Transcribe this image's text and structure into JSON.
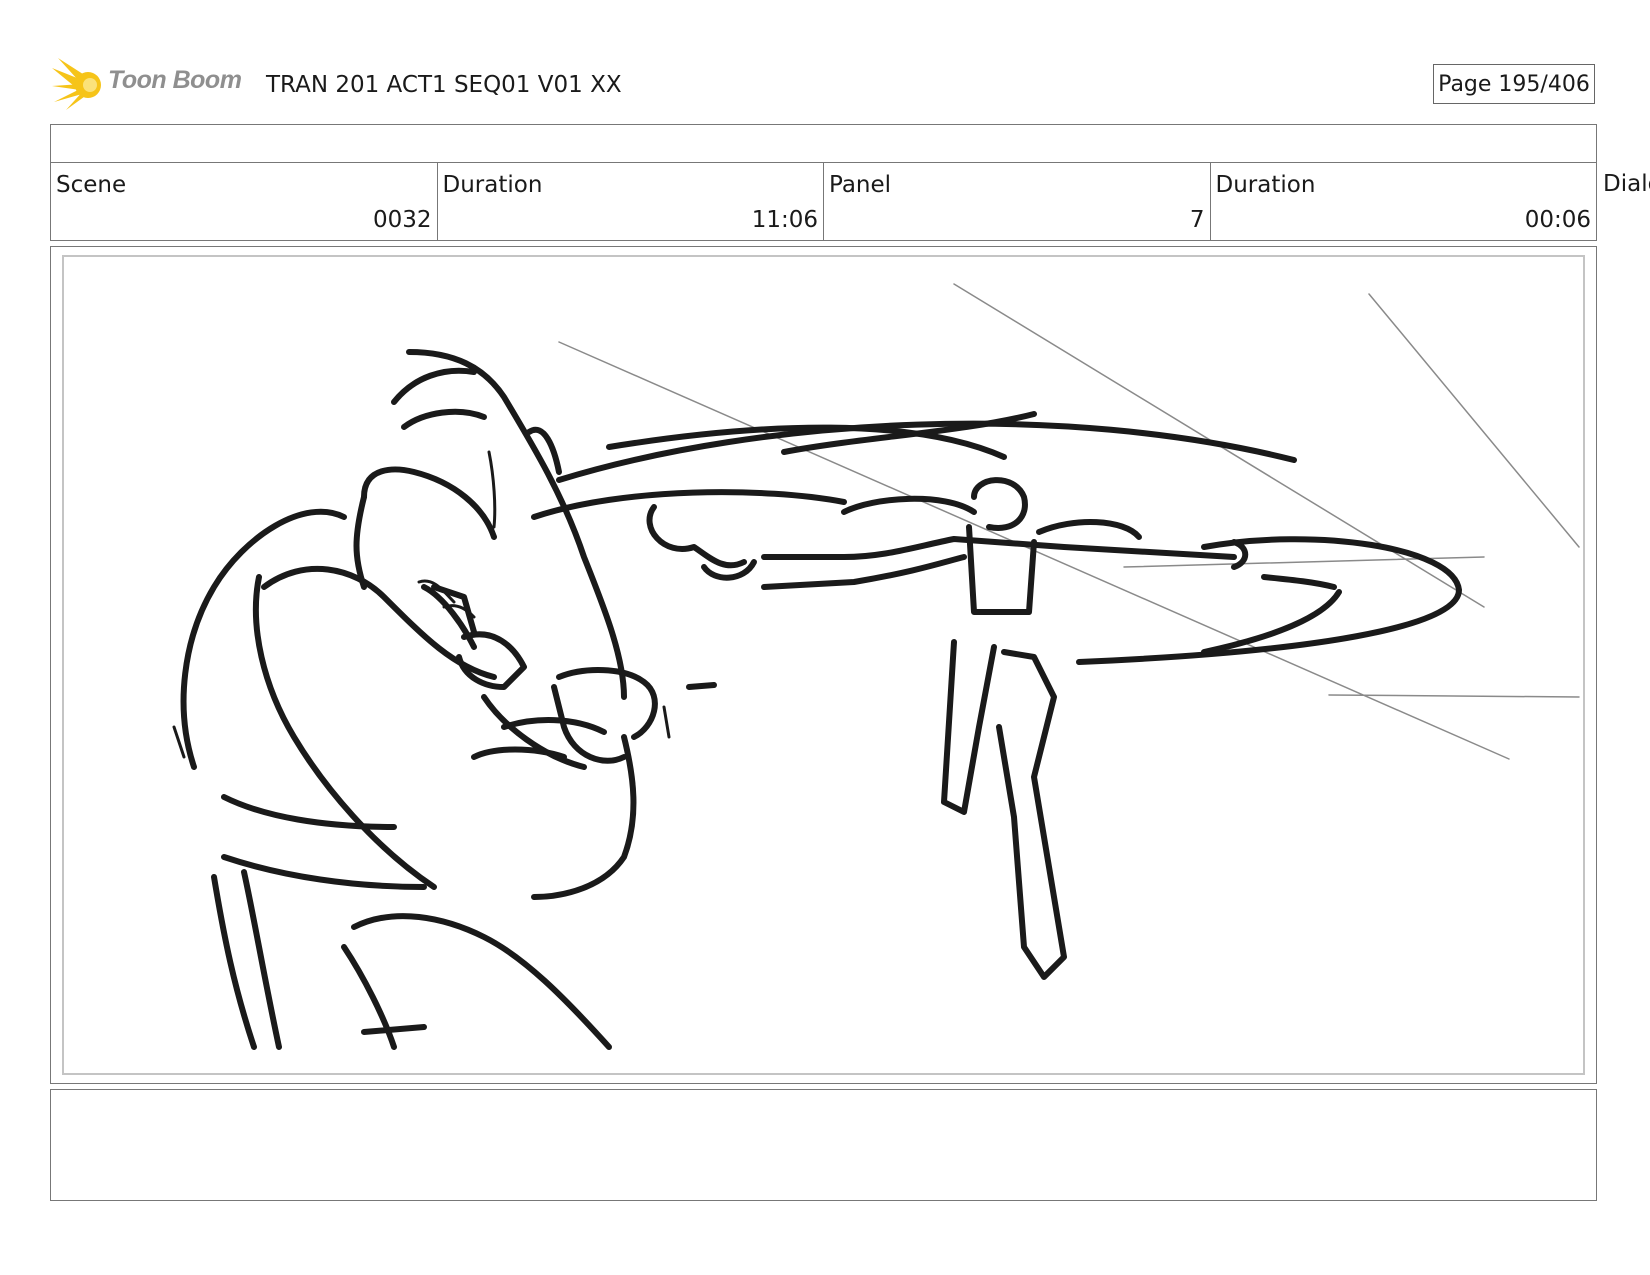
{
  "header": {
    "logo_label": "Toon Boom",
    "document_title": "TRAN 201 ACT1 SEQ01 V01 XX",
    "page_indicator": "Page 195/406"
  },
  "info": {
    "scene_label": "Scene",
    "scene_value": "0032",
    "scene_duration_label": "Duration",
    "scene_duration_value": "11:06",
    "panel_label": "Panel",
    "panel_value": "7",
    "panel_duration_label": "Duration",
    "panel_duration_value": "00:06",
    "dialog_label": "Dialo"
  },
  "colors": {
    "logo_accent": "#f6c419",
    "ink": "#1a1a1a",
    "frame_border": "#777777"
  },
  "notes": {
    "text": ""
  }
}
